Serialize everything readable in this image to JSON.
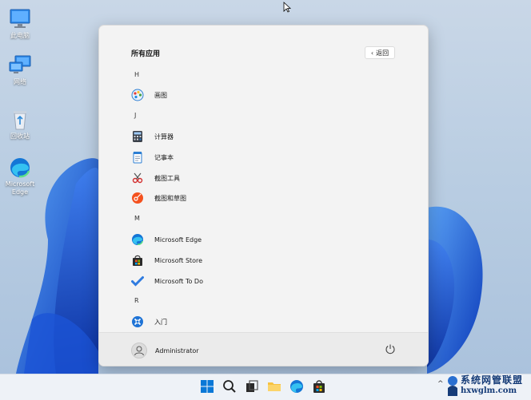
{
  "desktop": {
    "icons": [
      {
        "label": "此电脑",
        "icon": "this-pc-icon"
      },
      {
        "label": "网络",
        "icon": "network-icon"
      },
      {
        "label": "回收站",
        "icon": "recycle-bin-icon"
      },
      {
        "label": "Microsoft Edge",
        "icon": "edge-icon"
      }
    ]
  },
  "start_menu": {
    "title": "所有应用",
    "back_label": "返回",
    "groups": [
      {
        "letter": "H",
        "apps": [
          {
            "name": "画图",
            "icon": "paint-icon"
          }
        ]
      },
      {
        "letter": "J",
        "apps": [
          {
            "name": "计算器",
            "icon": "calculator-icon"
          },
          {
            "name": "记事本",
            "icon": "notepad-icon"
          },
          {
            "name": "截图工具",
            "icon": "snipping-tool-icon"
          },
          {
            "name": "截图和草图",
            "icon": "snip-sketch-icon"
          }
        ]
      },
      {
        "letter": "M",
        "apps": [
          {
            "name": "Microsoft Edge",
            "icon": "edge-icon"
          },
          {
            "name": "Microsoft Store",
            "icon": "store-icon"
          },
          {
            "name": "Microsoft To Do",
            "icon": "todo-icon"
          }
        ]
      },
      {
        "letter": "R",
        "apps": [
          {
            "name": "入门",
            "icon": "get-started-icon"
          }
        ]
      }
    ],
    "user": {
      "name": "Administrator"
    }
  },
  "taskbar": {
    "items": [
      "start-icon",
      "search-icon",
      "task-view-icon",
      "file-explorer-icon",
      "edge-icon",
      "store-icon"
    ]
  },
  "watermark": {
    "title": "系统网管联盟",
    "url": "hxwglm.com"
  },
  "colors": {
    "accent": "#0a5fd0",
    "wallpaper": "#1a56d8"
  }
}
